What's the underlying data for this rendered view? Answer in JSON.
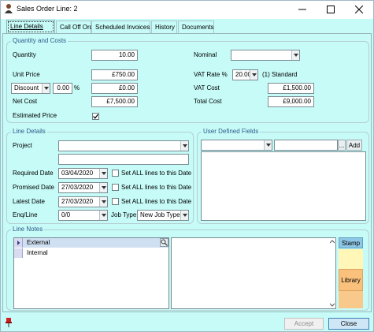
{
  "window": {
    "title": "Sales Order Line: 2"
  },
  "tabs": [
    {
      "label": "Line Details"
    },
    {
      "label": "Call Off Order"
    },
    {
      "label": "Scheduled Invoices"
    },
    {
      "label": "History"
    },
    {
      "label": "Documents"
    }
  ],
  "qc": {
    "legend": "Quantity and Costs",
    "quantity_label": "Quantity",
    "quantity_value": "10.00",
    "nominal_label": "Nominal",
    "nominal_value": "",
    "unit_price_label": "Unit Price",
    "unit_price_value": "£750.00",
    "vat_rate_label": "VAT Rate %",
    "vat_rate_value": "20.00",
    "vat_rate_desc": "(1) Standard",
    "discount_type": "Discount",
    "discount_pct": "0.00",
    "pct_sign": "%",
    "discount_value": "£0.00",
    "vat_cost_label": "VAT Cost",
    "vat_cost_value": "£1,500.00",
    "net_cost_label": "Net Cost",
    "net_cost_value": "£7,500.00",
    "total_cost_label": "Total Cost",
    "total_cost_value": "£9,000.00",
    "estimated_price_label": "Estimated Price",
    "estimated_price_checked": true
  },
  "ld": {
    "legend": "Line Details",
    "project_label": "Project",
    "project_value": "",
    "required_date_label": "Required Date",
    "required_date_value": "03/04/2020",
    "promised_date_label": "Promised Date",
    "promised_date_value": "27/03/2020",
    "latest_date_label": "Latest Date",
    "latest_date_value": "27/03/2020",
    "set_all_label": "Set ALL lines to this Date",
    "enq_line_label": "Enq/Line",
    "enq_line_value": "0/0",
    "job_type_label": "Job Type",
    "job_type_value": "New Job Type"
  },
  "udf": {
    "legend": "User Defined Fields",
    "add_label": "Add",
    "ellipsis": "..."
  },
  "ln": {
    "legend": "Line Notes",
    "items": [
      {
        "label": "External"
      },
      {
        "label": "Internal"
      }
    ],
    "stamp_label": "Stamp",
    "library_label": "Library"
  },
  "footer": {
    "accept_label": "Accept",
    "close_label": "Close"
  },
  "colors": {
    "background": "#c6fbf7",
    "close_button": "#cfe6f7",
    "library": "#f9c17c",
    "stamp": "#fff6b8"
  }
}
